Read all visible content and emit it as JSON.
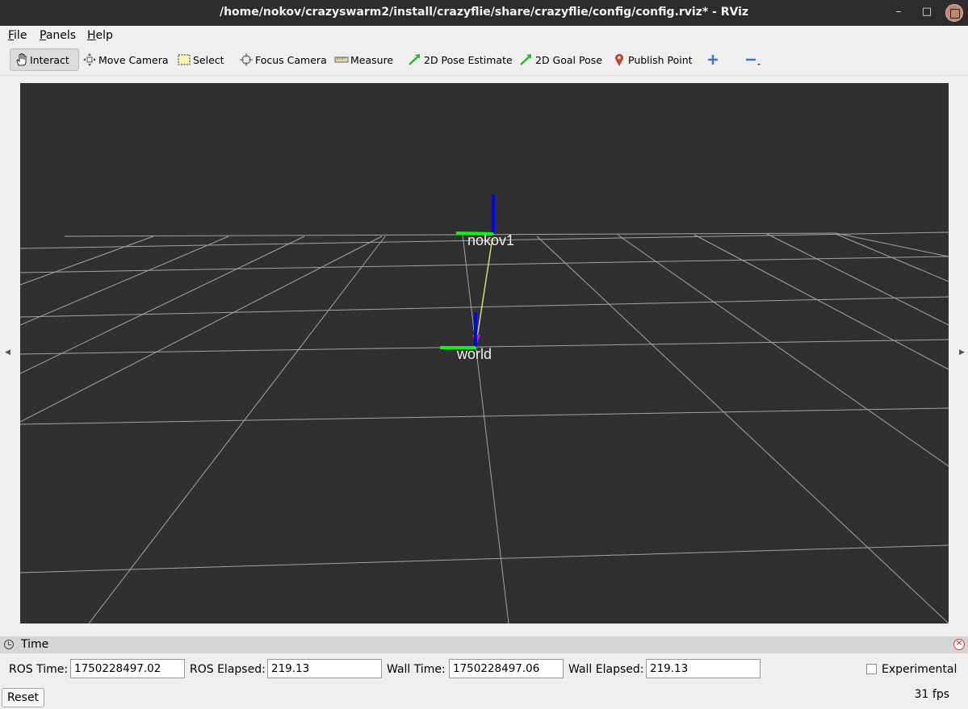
{
  "window": {
    "title": "/home/nokov/crazyswarm2/install/crazyflie/share/crazyflie/config/config.rviz* - RViz",
    "min_label": "–",
    "max_label": "□",
    "close_label": "✕",
    "app_icon": "rviz-icon"
  },
  "menubar": {
    "items": [
      {
        "label": "File",
        "mnemonic": "F",
        "rest": "ile"
      },
      {
        "label": "Panels",
        "mnemonic": "P",
        "rest": "anels"
      },
      {
        "label": "Help",
        "mnemonic": "H",
        "rest": "elp"
      }
    ]
  },
  "toolbar": {
    "tools": [
      {
        "label": "Interact",
        "icon": "hand-icon",
        "active": true
      },
      {
        "label": "Move Camera",
        "icon": "move-camera-icon"
      },
      {
        "label": "Select",
        "icon": "select-box-icon"
      },
      {
        "label": "Focus Camera",
        "icon": "focus-target-icon"
      },
      {
        "label": "Measure",
        "icon": "ruler-icon"
      },
      {
        "label": "2D Pose Estimate",
        "icon": "green-arrow-icon"
      },
      {
        "label": "2D Goal Pose",
        "icon": "green-arrow-icon"
      },
      {
        "label": "Publish Point",
        "icon": "map-pin-icon"
      }
    ],
    "add_tool_icon": "plus-icon",
    "remove_tool_icon": "minus-icon"
  },
  "viewport": {
    "background": "#303030",
    "grid_color": "#a0a0a0",
    "frames": [
      {
        "name": "nokov1"
      },
      {
        "name": "world"
      }
    ],
    "axis_colors": {
      "x": "#ff0000",
      "y": "#00ff00",
      "z": "#0000ff"
    },
    "tf_link_color": "#d8d86a"
  },
  "time_panel": {
    "title": "Time",
    "icon": "clock-icon",
    "ros_time_label": "ROS Time:",
    "ros_time_value": "1750228497.02",
    "ros_elapsed_label": "ROS Elapsed:",
    "ros_elapsed_value": "219.13",
    "wall_time_label": "Wall Time:",
    "wall_time_value": "1750228497.06",
    "wall_elapsed_label": "Wall Elapsed:",
    "wall_elapsed_value": "219.13",
    "experimental_label": "Experimental",
    "experimental_checked": false
  },
  "statusbar": {
    "reset_label": "Reset",
    "fps": "31 fps"
  }
}
